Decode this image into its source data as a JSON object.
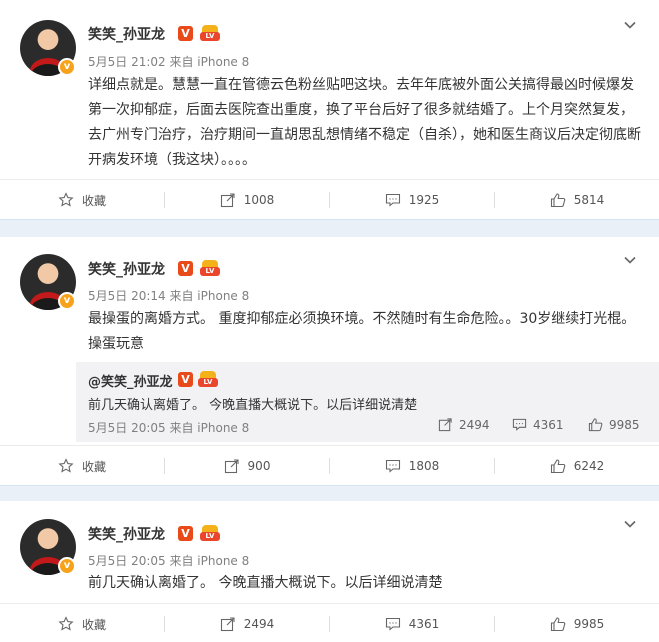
{
  "posts": [
    {
      "user": "笑笑_孙亚龙",
      "v_badge": "V",
      "crown_text": "LV",
      "meta": "5月5日 21:02 来自 iPhone 8",
      "text": "详细点就是。慧慧一直在管德云色粉丝贴吧这块。去年年底被外面公关搞得最凶时候爆发第一次抑郁症，后面去医院查出重度，换了平台后好了很多就结婚了。上个月突然复发，去广州专门治疗，治疗期间一直胡思乱想情绪不稳定（自杀），她和医生商议后决定彻底断开病发环境（我这块）。。。。",
      "actions": {
        "favorite": "收藏",
        "forward": "1008",
        "comment": "1925",
        "like": "5814"
      }
    },
    {
      "user": "笑笑_孙亚龙",
      "v_badge": "V",
      "crown_text": "LV",
      "meta": "5月5日 20:14 来自 iPhone 8",
      "text": "最操蛋的离婚方式。 重度抑郁症必须换环境。不然随时有生命危险。。30岁继续打光棍。操蛋玩意",
      "quote": {
        "user": "@笑笑_孙亚龙",
        "text": "前几天确认离婚了。  今晚直播大概说下。以后详细说清楚",
        "meta": "5月5日 20:05 来自 iPhone 8",
        "forward": "2494",
        "comment": "4361",
        "like": "9985"
      },
      "actions": {
        "favorite": "收藏",
        "forward": "900",
        "comment": "1808",
        "like": "6242"
      }
    },
    {
      "user": "笑笑_孙亚龙",
      "v_badge": "V",
      "crown_text": "LV",
      "meta": "5月5日 20:05 来自 iPhone 8",
      "text": "前几天确认离婚了。  今晚直播大概说下。以后详细说清楚",
      "actions": {
        "favorite": "收藏",
        "forward": "2494",
        "comment": "4361",
        "like": "9985"
      }
    }
  ]
}
